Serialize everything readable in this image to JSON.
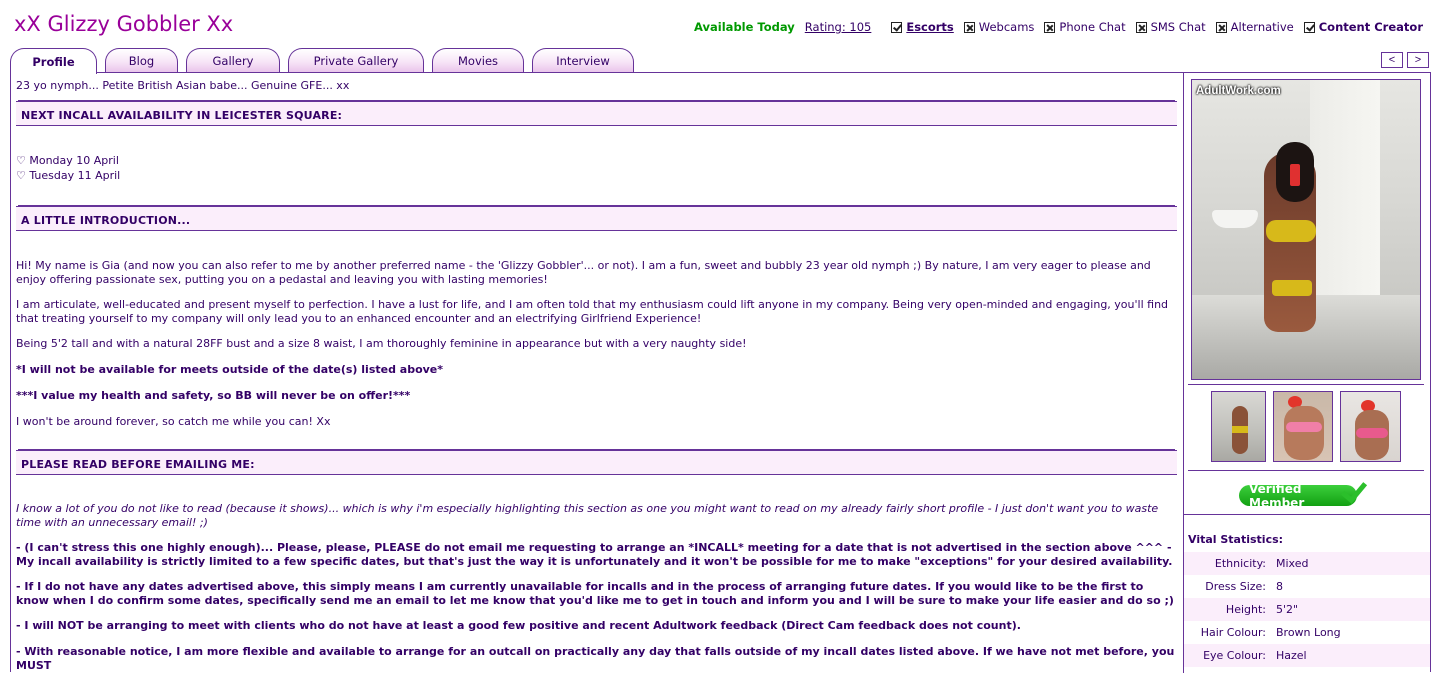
{
  "header": {
    "title": "xX Glizzy Gobbler Xx",
    "availability": "Available Today",
    "rating": "Rating: 105",
    "services": [
      {
        "label": "Escorts",
        "state": "check",
        "bold": true,
        "underline": true
      },
      {
        "label": "Webcams",
        "state": "cross"
      },
      {
        "label": "Phone Chat",
        "state": "cross"
      },
      {
        "label": "SMS Chat",
        "state": "cross"
      },
      {
        "label": "Alternative",
        "state": "cross"
      },
      {
        "label": "Content Creator",
        "state": "check",
        "bold": true
      }
    ]
  },
  "tabs": [
    {
      "label": "Profile",
      "active": true
    },
    {
      "label": "Blog"
    },
    {
      "label": "Gallery"
    },
    {
      "label": "Private Gallery"
    },
    {
      "label": "Movies"
    },
    {
      "label": "Interview"
    }
  ],
  "pager": {
    "prev": "<",
    "next": ">"
  },
  "profile": {
    "tagline": "23 yo nymph... Petite British Asian babe... Genuine GFE... xx",
    "sec1_heading": "NEXT INCALL AVAILABILITY IN LEICESTER SQUARE:",
    "dates": [
      "♡ Monday 10 April",
      "♡ Tuesday 11 April"
    ],
    "sec2_heading": "A LITTLE INTRODUCTION...",
    "intro": [
      "Hi! My name is Gia (and now you can also refer to me by another preferred name - the 'Glizzy Gobbler'... or not). I am a fun, sweet and bubbly 23 year old nymph ;) By nature, I am very eager to please and enjoy offering passionate sex, putting you on a pedastal and leaving you with lasting memories!",
      "I am articulate, well-educated and present myself to perfection. I have a lust for life, and I am often told that my enthusiasm could lift anyone in my company. Being very open-minded and engaging, you'll find that treating yourself to my company will only lead you to an enhanced encounter and an electrifying Girlfriend Experience!",
      "Being 5'2 tall and with a natural 28FF bust and a size 8 waist, I am thoroughly feminine in appearance but with a very naughty side!",
      "*I will not be available for meets outside of the date(s) listed above*",
      "***I value my health and safety, so BB will never be on offer!***",
      "I won't be around forever, so catch me while you can! Xx"
    ],
    "sec3_heading": "PLEASE READ BEFORE EMAILING ME:",
    "read": [
      "I know a lot of you do not like to read (because it shows)... which is why i'm especially highlighting this section as one you might want to read on my already fairly short profile - I just don't want you to waste time with an unnecessary email! ;)",
      "- (I can't stress this one highly enough)... Please, please, PLEASE do not email me requesting to arrange an *INCALL* meeting for a date that is not advertised in the section above ^^^ - My incall availability is strictly limited to a few specific dates, but that's just the way it is unfortunately and it won't be possible for me to make \"exceptions\" for your desired availability.",
      "- If I do not have any dates advertised above, this simply means I am currently unavailable for incalls and in the process of arranging future dates. If you would like to be the first to know when I do confirm some dates, specifically send me an email to let me know that you'd like me to get in touch and inform you and I will be sure to make your life easier and do so ;)",
      "- I will NOT be arranging to meet with clients who do not have at least a good few positive and recent Adultwork feedback (Direct Cam feedback does not count).",
      "- With reasonable notice, I am more flexible and available to arrange for an outcall on practically any day that falls outside of my incall dates listed above. If we have not met before, you MUST"
    ]
  },
  "sidebar": {
    "watermark": "AdultWork.com",
    "verified": "Verified Member",
    "vitals_title": "Vital Statistics:",
    "vitals": [
      {
        "label": "Ethnicity:",
        "value": "Mixed"
      },
      {
        "label": "Dress Size:",
        "value": "8"
      },
      {
        "label": "Height:",
        "value": "5'2\""
      },
      {
        "label": "Hair Colour:",
        "value": "Brown Long"
      },
      {
        "label": "Eye Colour:",
        "value": "Hazel"
      }
    ]
  },
  "colors": {
    "title": "#990099",
    "text": "#330066",
    "available": "#009900",
    "section_bg": "#fbeefb",
    "border": "#663399"
  }
}
